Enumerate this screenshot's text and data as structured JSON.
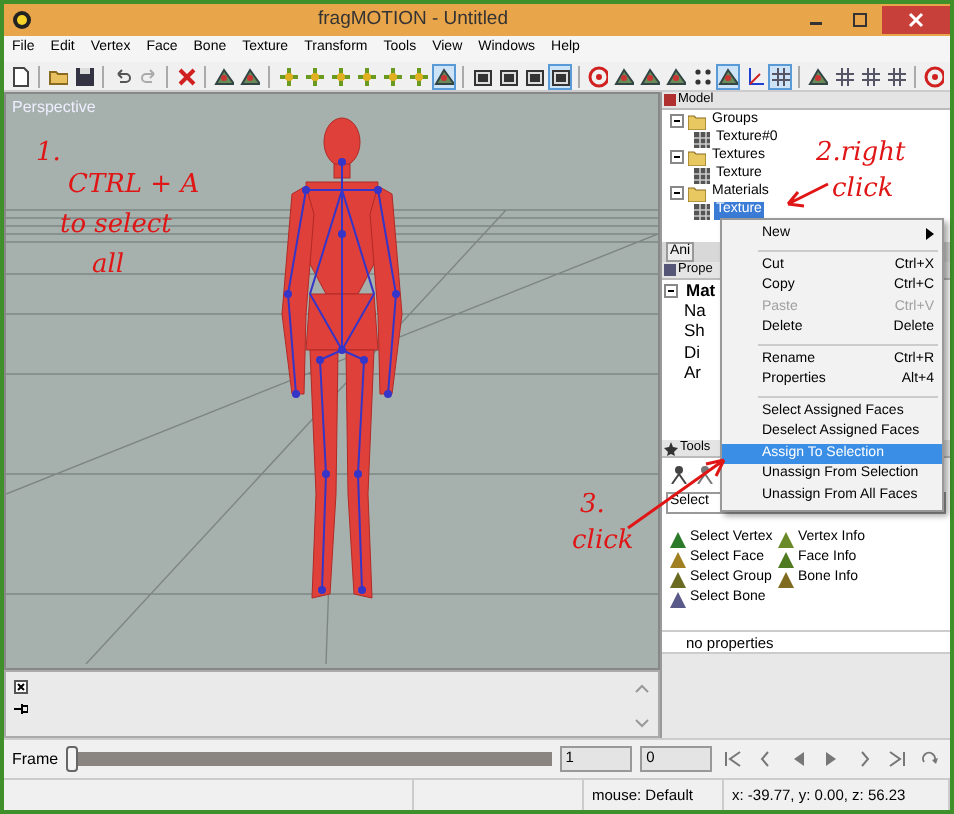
{
  "window": {
    "title": "fragMOTION - Untitled"
  },
  "menu": [
    "File",
    "Edit",
    "Vertex",
    "Face",
    "Bone",
    "Texture",
    "Transform",
    "Tools",
    "View",
    "Windows",
    "Help"
  ],
  "toolbar": [
    {
      "kind": "new",
      "pressed": false
    },
    {
      "kind": "separator"
    },
    {
      "kind": "open",
      "pressed": false
    },
    {
      "kind": "save",
      "pressed": false
    },
    {
      "kind": "separator"
    },
    {
      "kind": "undo",
      "pressed": false
    },
    {
      "kind": "redo",
      "pressed": false
    },
    {
      "kind": "separator"
    },
    {
      "kind": "delete",
      "pressed": false
    },
    {
      "kind": "separator"
    },
    {
      "kind": "shape",
      "pressed": false
    },
    {
      "kind": "shape",
      "pressed": false
    },
    {
      "kind": "separator"
    },
    {
      "kind": "move",
      "pressed": false
    },
    {
      "kind": "move",
      "pressed": false
    },
    {
      "kind": "move",
      "pressed": false
    },
    {
      "kind": "move",
      "pressed": false
    },
    {
      "kind": "move",
      "pressed": false
    },
    {
      "kind": "move",
      "pressed": false
    },
    {
      "kind": "shape",
      "pressed": true
    },
    {
      "kind": "separator"
    },
    {
      "kind": "square",
      "pressed": false
    },
    {
      "kind": "square",
      "pressed": false
    },
    {
      "kind": "square",
      "pressed": false
    },
    {
      "kind": "square",
      "pressed": true
    },
    {
      "kind": "separator"
    },
    {
      "kind": "target",
      "pressed": false
    },
    {
      "kind": "shape",
      "pressed": false
    },
    {
      "kind": "shape",
      "pressed": false
    },
    {
      "kind": "shape",
      "pressed": false
    },
    {
      "kind": "dots",
      "pressed": false
    },
    {
      "kind": "shape",
      "pressed": true
    },
    {
      "kind": "axes",
      "pressed": false
    },
    {
      "kind": "grid",
      "pressed": true
    },
    {
      "kind": "separator"
    },
    {
      "kind": "shape",
      "pressed": false
    },
    {
      "kind": "grid",
      "pressed": false
    },
    {
      "kind": "grid",
      "pressed": false
    },
    {
      "kind": "grid",
      "pressed": false
    },
    {
      "kind": "separator"
    },
    {
      "kind": "target",
      "pressed": false
    }
  ],
  "viewport": {
    "label": "Perspective"
  },
  "annotations": [
    "1.",
    "CTRL + A",
    "to select",
    "all",
    "2.right",
    "click",
    "3.",
    "click"
  ],
  "model_panel": {
    "title": "Model",
    "tree": [
      {
        "label": "Groups",
        "expanded": true,
        "selected": false,
        "children": [
          {
            "label": "Texture#0",
            "selected": false
          }
        ]
      },
      {
        "label": "Textures",
        "expanded": true,
        "selected": false,
        "children": [
          {
            "label": "Texture",
            "selected": false
          }
        ]
      },
      {
        "label": "Materials",
        "expanded": true,
        "selected": false,
        "children": [
          {
            "label": "Texture",
            "selected": true
          }
        ]
      }
    ]
  },
  "tab": {
    "label": "Ani"
  },
  "properties_panel": {
    "title": "Prope",
    "heading": "Mat",
    "rows": [
      "Na",
      "Sh",
      "Di",
      "Ar"
    ]
  },
  "tools_panel": {
    "title": "Tools",
    "mode": "Select",
    "items": [
      "Select Vertex",
      "Vertex Info",
      "Select Face",
      "Face Info",
      "Select Group",
      "Bone Info",
      "Select Bone"
    ]
  },
  "property_grid": {
    "text": "no properties"
  },
  "context_menu": [
    {
      "kind": "item",
      "label": "New",
      "submenu": true,
      "disabled": false,
      "selected": false
    },
    {
      "kind": "separator"
    },
    {
      "kind": "item",
      "label": "Cut",
      "shortcut": "Ctrl+X",
      "disabled": false,
      "selected": false
    },
    {
      "kind": "item",
      "label": "Copy",
      "shortcut": "Ctrl+C",
      "disabled": false,
      "selected": false
    },
    {
      "kind": "item",
      "label": "Paste",
      "shortcut": "Ctrl+V",
      "disabled": true,
      "selected": false
    },
    {
      "kind": "item",
      "label": "Delete",
      "shortcut": "Delete",
      "disabled": false,
      "selected": false
    },
    {
      "kind": "separator"
    },
    {
      "kind": "item",
      "label": "Rename",
      "shortcut": "Ctrl+R",
      "disabled": false,
      "selected": false
    },
    {
      "kind": "item",
      "label": "Properties",
      "shortcut": "Alt+4",
      "disabled": false,
      "selected": false
    },
    {
      "kind": "separator"
    },
    {
      "kind": "item",
      "label": "Select Assigned Faces",
      "disabled": false,
      "selected": false
    },
    {
      "kind": "item",
      "label": "Deselect Assigned Faces",
      "disabled": false,
      "selected": false
    },
    {
      "kind": "item",
      "label": "Assign To Selection",
      "disabled": false,
      "selected": true
    },
    {
      "kind": "item",
      "label": "Unassign From Selection",
      "disabled": false,
      "selected": false
    },
    {
      "kind": "item",
      "label": "Unassign From All Faces",
      "disabled": false,
      "selected": false
    }
  ],
  "timeline": {
    "label": "Frame",
    "level": 0,
    "fields": [
      "1",
      "0"
    ]
  },
  "status_bar": [
    "mouse: Default",
    "x: -39.77, y: 0.00, z: 56.23"
  ]
}
